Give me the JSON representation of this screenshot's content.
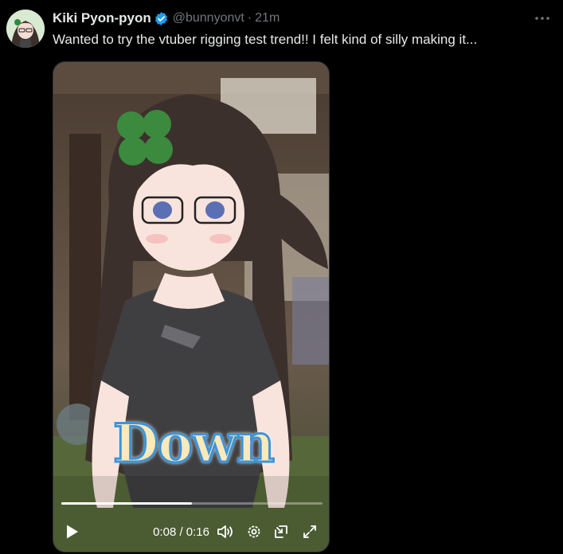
{
  "post": {
    "author_name": "Kiki Pyon-pyon",
    "handle": "@bunnyonvt",
    "separator": "·",
    "time_ago": "21m",
    "text": "Wanted to try the vtuber rigging test trend!! I felt kind of silly making it...",
    "verified_icon": "verified-badge-icon",
    "more_icon": "more-options-icon"
  },
  "video": {
    "caption_text": "Down",
    "current_time": "0:08",
    "duration": "0:16",
    "time_display": "0:08 / 0:16",
    "progress_fraction": 0.5,
    "icons": [
      "play-icon",
      "volume-icon",
      "settings-icon",
      "picture-in-picture-icon",
      "fullscreen-icon"
    ]
  },
  "colors": {
    "background": "#000000",
    "primary_text": "#e7e9ea",
    "secondary_text": "#71767b",
    "verified_blue": "#1d9bf0",
    "caption_fill": "#fbe9b9",
    "caption_outline": "#3f94d8"
  }
}
